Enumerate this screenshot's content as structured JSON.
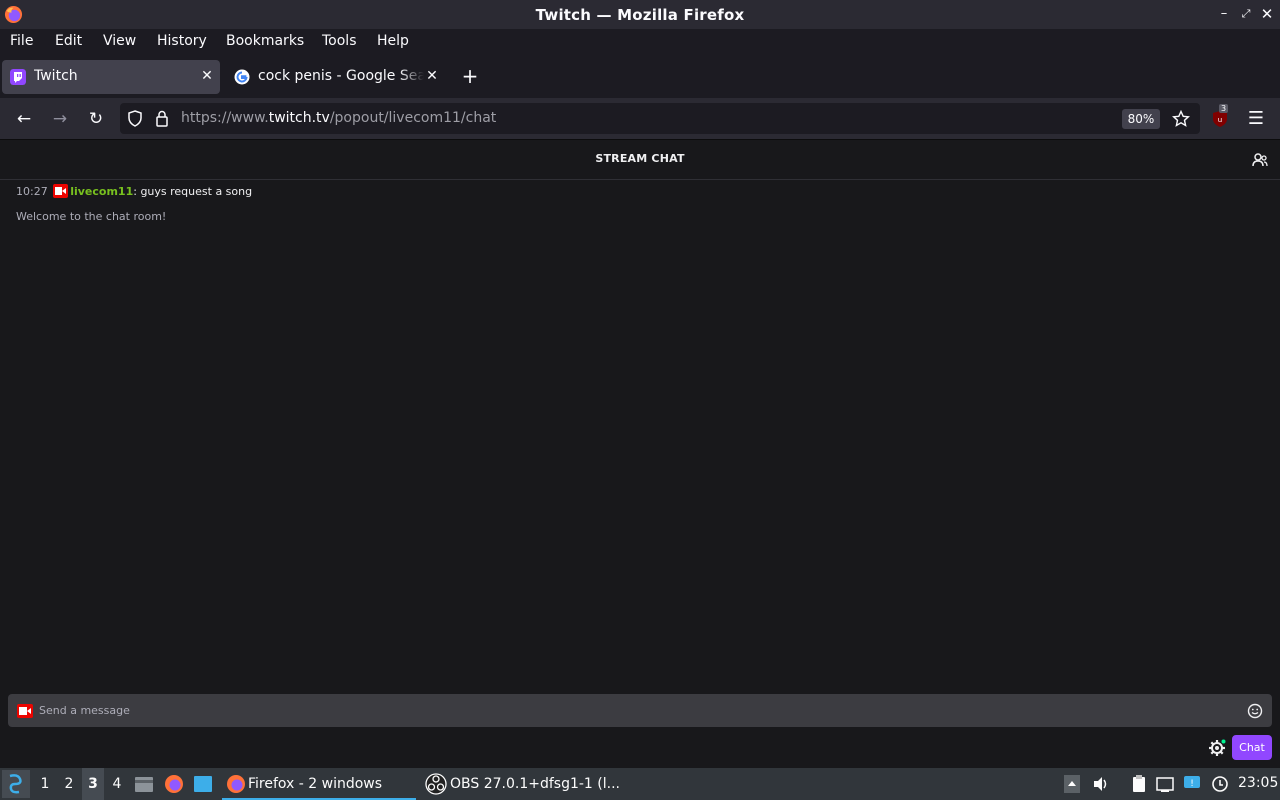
{
  "window": {
    "title": "Twitch — Mozilla Firefox"
  },
  "menu": {
    "file": "File",
    "edit": "Edit",
    "view": "View",
    "history": "History",
    "bookmarks": "Bookmarks",
    "tools": "Tools",
    "help": "Help"
  },
  "tabs": [
    {
      "label": "Twitch",
      "favicon": "twitch-icon",
      "active": true
    },
    {
      "label": "cock penis - Google Search",
      "favicon": "google-icon",
      "active": false
    }
  ],
  "navbar": {
    "url_prefix": "https://www.",
    "url_domain": "twitch.tv",
    "url_path": "/popout/livecom11/chat",
    "zoom": "80%",
    "extension_badge": "3"
  },
  "chat": {
    "header": "STREAM CHAT",
    "messages": [
      {
        "time": "10:27",
        "user": "livecom11",
        "sep": ": ",
        "text": "guys request a song",
        "user_color": "#78c01f"
      }
    ],
    "welcome": "Welcome to the chat room!",
    "input_placeholder": "Send a message",
    "send_label": "Chat"
  },
  "taskbar": {
    "workspaces": [
      "1",
      "2",
      "3",
      "4"
    ],
    "active_workspace": "3",
    "tasks": [
      {
        "label": "Firefox - 2 windows",
        "icon": "firefox-icon"
      },
      {
        "label": "OBS 27.0.1+dfsg1-1 (l...",
        "icon": "obs-icon"
      }
    ],
    "clock": "23:05"
  },
  "colors": {
    "accent": "#9147ff",
    "live_badge": "#eb0400",
    "bg": "#18181b"
  }
}
